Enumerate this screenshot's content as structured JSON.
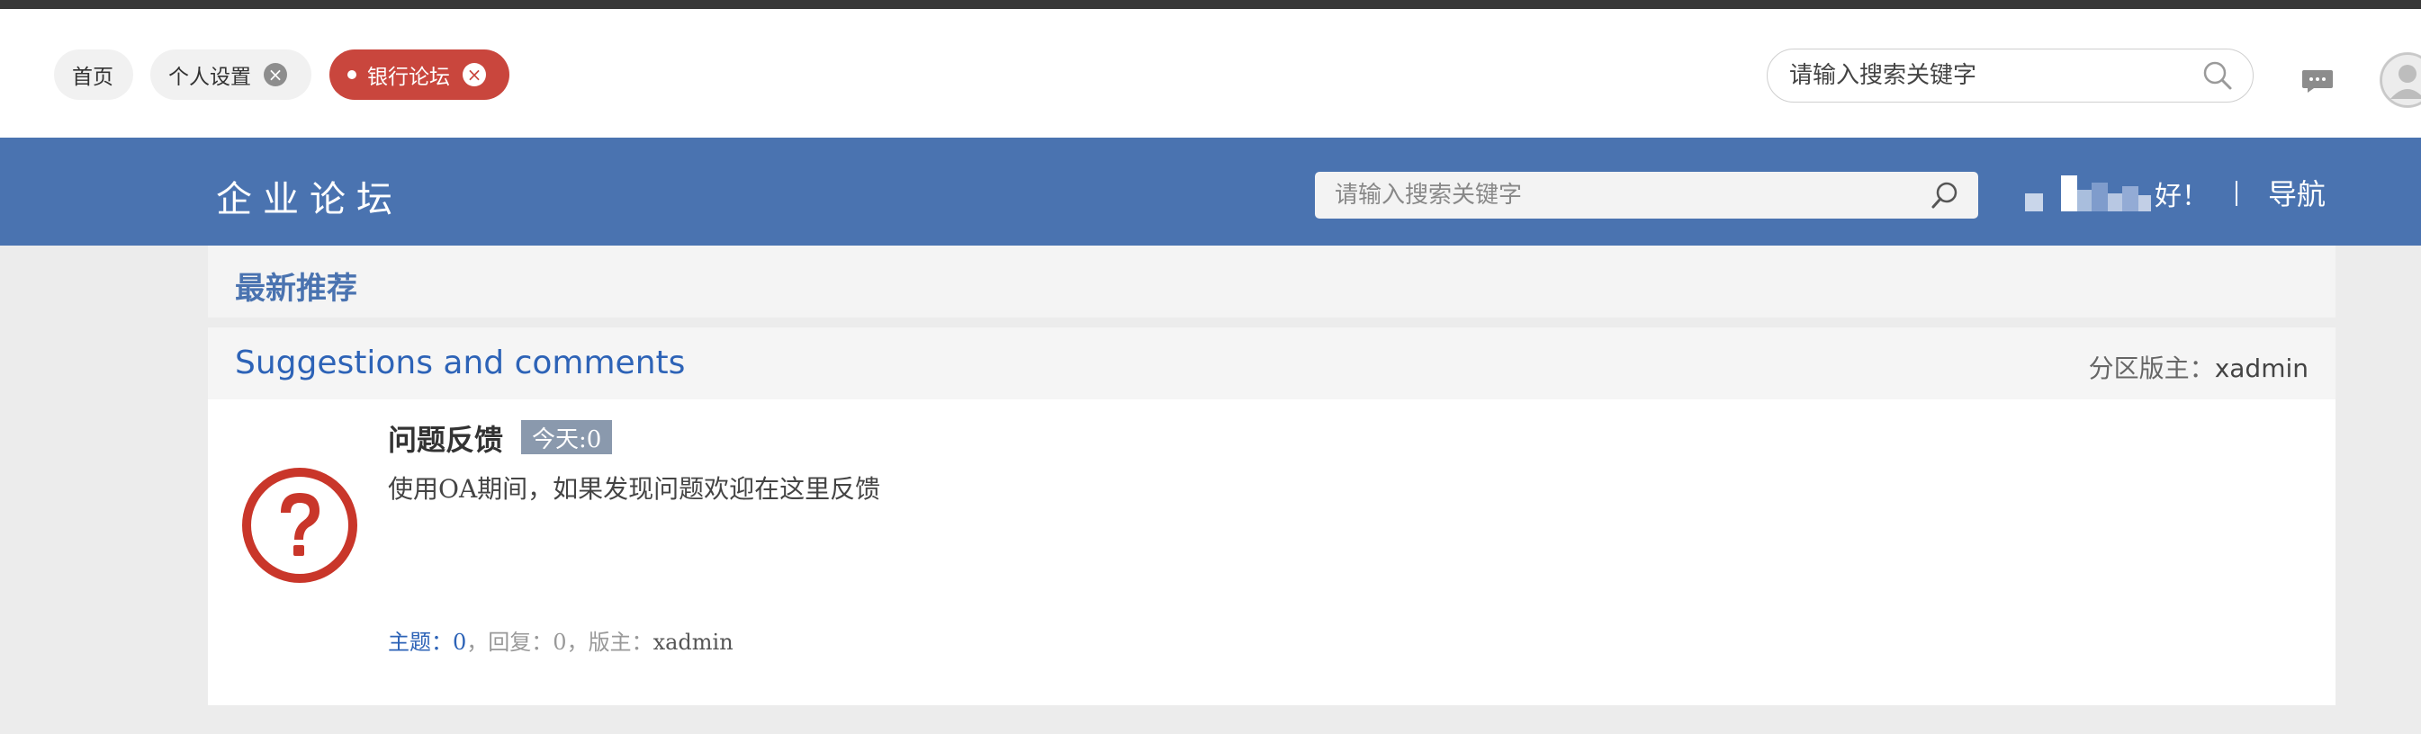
{
  "tabs": [
    {
      "label": "首页",
      "closable": false,
      "active": false
    },
    {
      "label": "个人设置",
      "closable": true,
      "active": false
    },
    {
      "label": "银行论坛",
      "closable": true,
      "active": true
    }
  ],
  "top_search": {
    "placeholder": "请输入搜索关键字",
    "icon": "search-icon"
  },
  "header": {
    "logo": "企业论坛",
    "search_placeholder": "请输入搜索关键字",
    "greeting_suffix": "好！",
    "nav": "导航",
    "bg_color": "#4a73b0"
  },
  "recommend": {
    "title": "最新推荐"
  },
  "section": {
    "title": "Suggestions and comments",
    "moderator_label": "分区版主：",
    "moderator": "xadmin"
  },
  "forum": {
    "name": "问题反馈",
    "today": "今天:0",
    "description": "使用OA期间，如果发现问题欢迎在这里反馈",
    "topics_label": "主题：",
    "topics": "0",
    "replies_label": "回复：",
    "replies": "0",
    "mod_label": "版主：",
    "moderator": "xadmin",
    "icon": "question-mark-icon",
    "icon_color": "#c9362a"
  },
  "colors": {
    "accent_tab": "#c9463d",
    "link": "#2d63b7"
  }
}
